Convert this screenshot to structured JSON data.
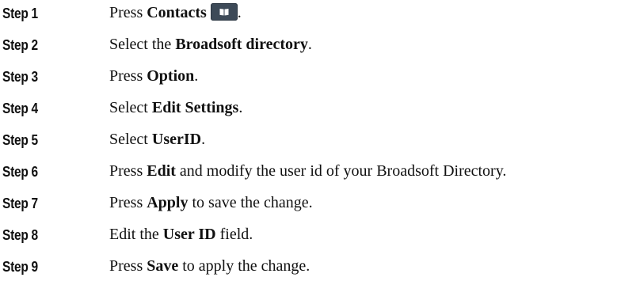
{
  "steps": [
    {
      "label": "Step 1",
      "parts": [
        {
          "text": "Press ",
          "bold": false
        },
        {
          "text": "Contacts",
          "bold": true
        },
        {
          "icon": "contacts-book-icon"
        },
        {
          "text": ".",
          "bold": false
        }
      ]
    },
    {
      "label": "Step 2",
      "parts": [
        {
          "text": "Select the ",
          "bold": false
        },
        {
          "text": "Broadsoft directory",
          "bold": true
        },
        {
          "text": ".",
          "bold": false
        }
      ]
    },
    {
      "label": "Step 3",
      "parts": [
        {
          "text": "Press ",
          "bold": false
        },
        {
          "text": "Option",
          "bold": true
        },
        {
          "text": ".",
          "bold": false
        }
      ]
    },
    {
      "label": "Step 4",
      "parts": [
        {
          "text": "Select ",
          "bold": false
        },
        {
          "text": "Edit Settings",
          "bold": true
        },
        {
          "text": ".",
          "bold": false
        }
      ]
    },
    {
      "label": "Step 5",
      "parts": [
        {
          "text": "Select ",
          "bold": false
        },
        {
          "text": "UserID",
          "bold": true
        },
        {
          "text": ".",
          "bold": false
        }
      ]
    },
    {
      "label": "Step 6",
      "parts": [
        {
          "text": "Press ",
          "bold": false
        },
        {
          "text": "Edit",
          "bold": true
        },
        {
          "text": " and modify the user id of your Broadsoft Directory.",
          "bold": false
        }
      ]
    },
    {
      "label": "Step 7",
      "parts": [
        {
          "text": "Press ",
          "bold": false
        },
        {
          "text": "Apply",
          "bold": true
        },
        {
          "text": " to save the change.",
          "bold": false
        }
      ]
    },
    {
      "label": "Step 8",
      "parts": [
        {
          "text": "Edit the ",
          "bold": false
        },
        {
          "text": "User ID",
          "bold": true
        },
        {
          "text": " field.",
          "bold": false
        }
      ]
    },
    {
      "label": "Step 9",
      "parts": [
        {
          "text": "Press ",
          "bold": false
        },
        {
          "text": "Save",
          "bold": true
        },
        {
          "text": " to apply the change.",
          "bold": false
        }
      ]
    }
  ],
  "colors": {
    "text": "#111111",
    "key_background": "#3d4a58",
    "key_glyph": "#ffffff"
  }
}
